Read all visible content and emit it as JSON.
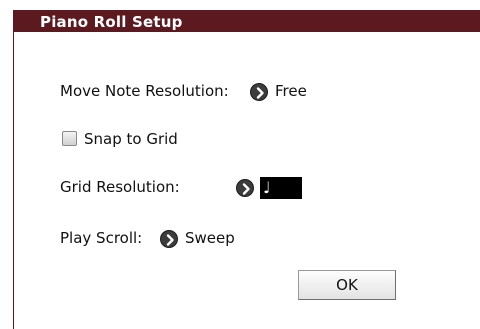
{
  "dialog": {
    "title": "Piano Roll Setup"
  },
  "move_note_resolution": {
    "label": "Move Note Resolution:",
    "value": "Free",
    "button_icon": "right-arrow-circle-icon"
  },
  "snap_to_grid": {
    "label": "Snap to Grid",
    "checked": false
  },
  "grid_resolution": {
    "label": "Grid Resolution:",
    "value": "♩",
    "button_icon": "right-arrow-circle-icon"
  },
  "play_scroll": {
    "label": "Play Scroll:",
    "value": "Sweep",
    "button_icon": "right-arrow-circle-icon"
  },
  "ok_button": {
    "label": "OK"
  },
  "colors": {
    "titlebar": "#5c1a20",
    "selected_value_bg": "#000000"
  }
}
